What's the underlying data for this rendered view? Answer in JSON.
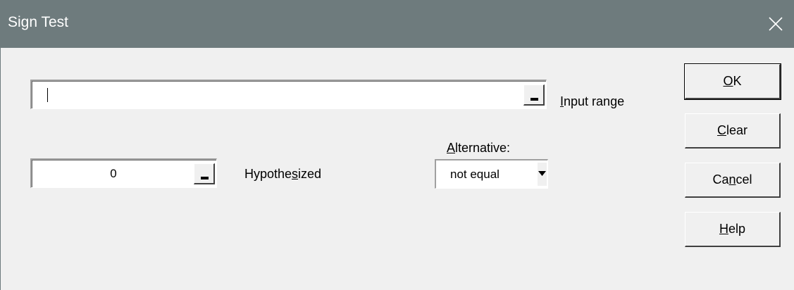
{
  "window": {
    "title": "Sign Test"
  },
  "input_range": {
    "value": "",
    "label_prefix": "",
    "label_underlined": "I",
    "label_rest": "nput range"
  },
  "hypothesized": {
    "value": "0",
    "label_prefix": "Hypothe",
    "label_underlined": "s",
    "label_rest": "ized"
  },
  "alternative": {
    "label_prefix": "",
    "label_underlined": "A",
    "label_rest": "lternative:",
    "selected": "not equal"
  },
  "buttons": {
    "ok": {
      "prefix": "",
      "underlined": "O",
      "rest": "K"
    },
    "clear": {
      "prefix": "",
      "underlined": "C",
      "rest": "lear"
    },
    "cancel": {
      "prefix": "Ca",
      "underlined": "n",
      "rest": "cel"
    },
    "help": {
      "prefix": "",
      "underlined": "H",
      "rest": "elp"
    }
  },
  "icons": {
    "close": "close-icon",
    "collapse": "range-collapse-icon",
    "dropdown": "chevron-down-icon"
  }
}
